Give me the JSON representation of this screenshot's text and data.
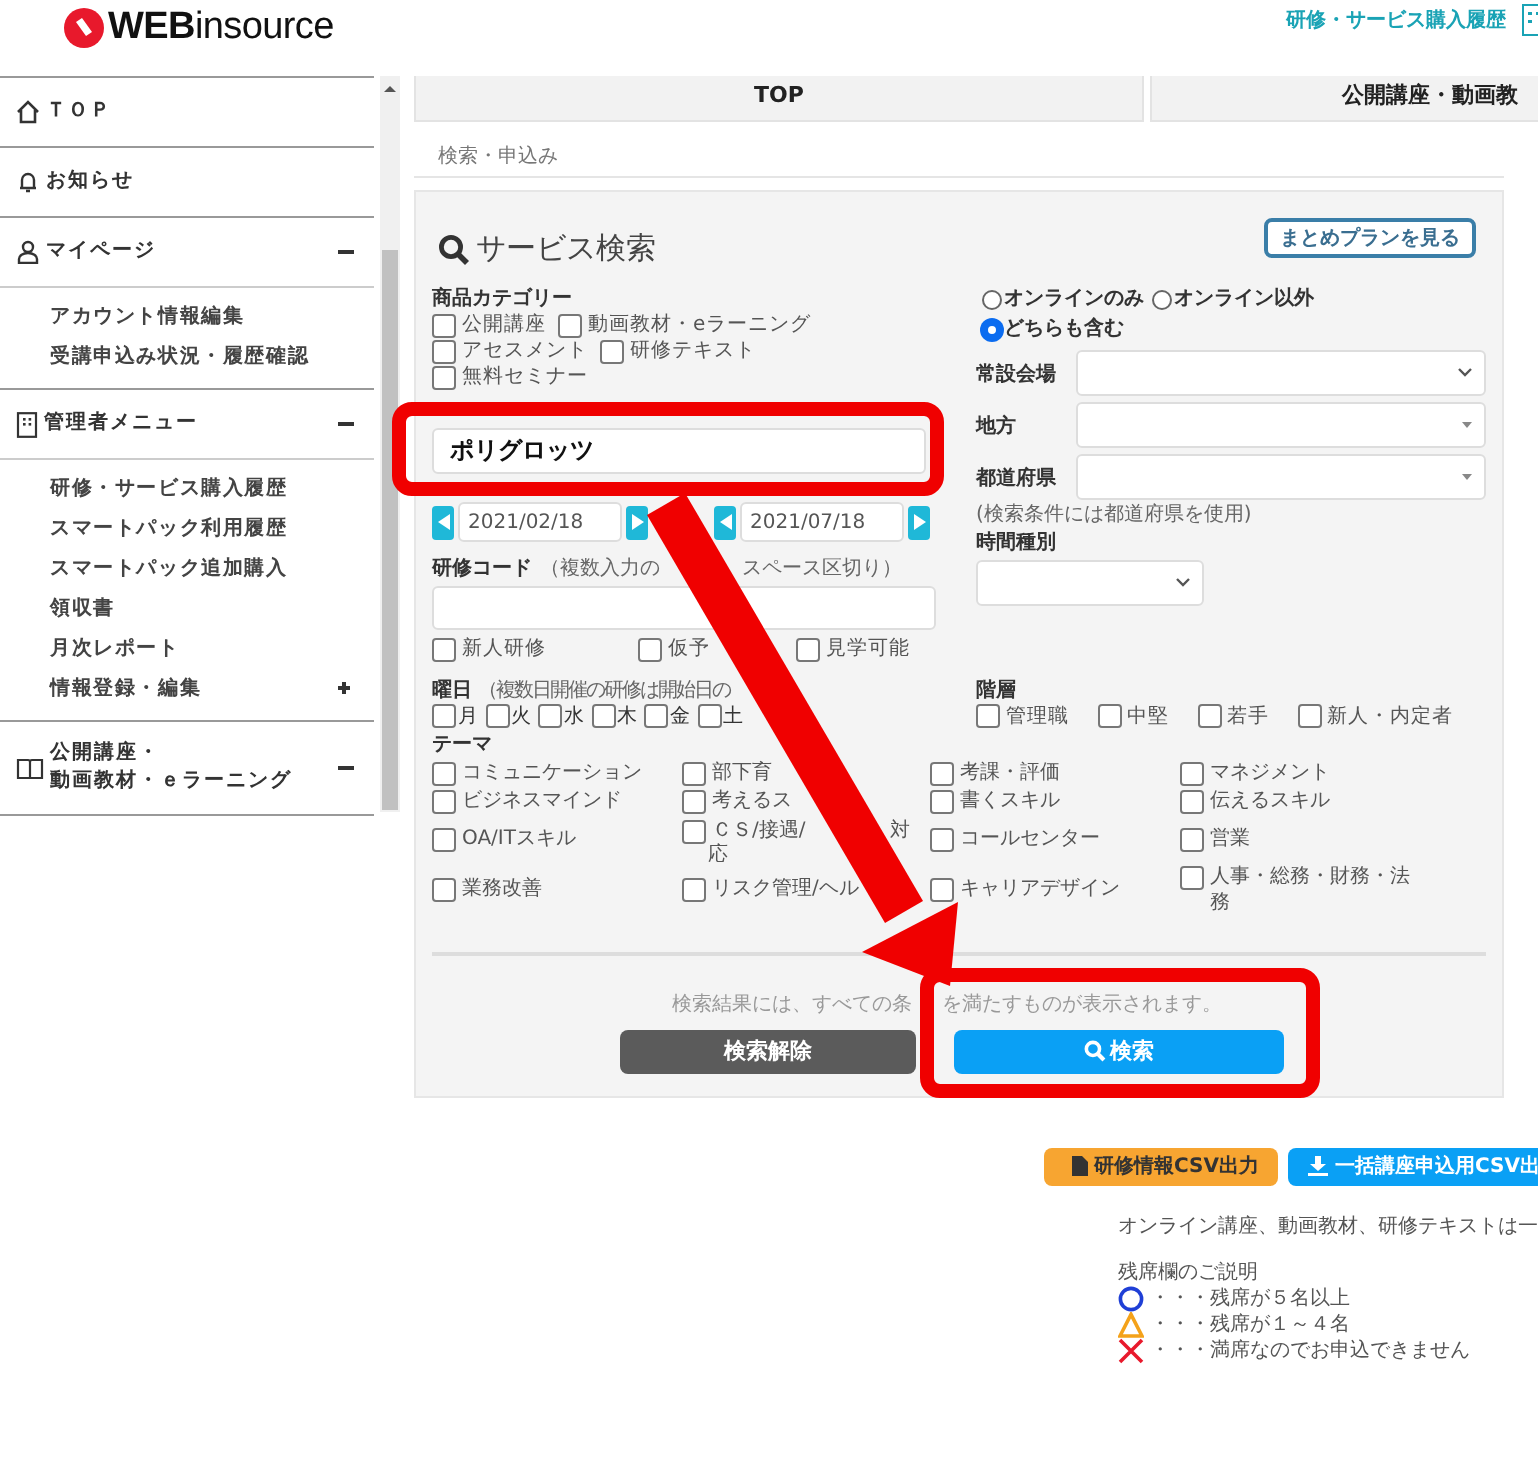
{
  "header": {
    "logo": "**WEB**insource",
    "link": "研修・サービス購入履歴"
  },
  "sidebar": {
    "sections": [
      {
        "label": "ＴＯＰ"
      },
      {
        "label": "お知らせ"
      },
      {
        "label": "マイページ",
        "expanded": true,
        "children": [
          {
            "label": "アカウント情報編集"
          },
          {
            "label": "受講申込み状況・履歴確認"
          }
        ]
      },
      {
        "label": "管理者メニュー",
        "expanded": true,
        "children": [
          {
            "label": "研修・サービス購入履歴"
          },
          {
            "label": "スマートパック利用履歴"
          },
          {
            "label": "スマートパック追加購入"
          },
          {
            "label": "領収書"
          },
          {
            "label": "月次レポート"
          },
          {
            "label": "情報登録・編集",
            "expanded": false
          }
        ]
      },
      {
        "label": "公開講座・動画教材・ｅラーニング",
        "expanded": true
      }
    ]
  },
  "tabs": [
    {
      "label": "TOP"
    },
    {
      "label": "公開講座・動画教"
    }
  ],
  "breadcrumb": "検索・申込み",
  "search": {
    "title": "サービス検索",
    "plan_button": "まとめプランを見る",
    "category_label": "商品カテゴリー",
    "categories": [
      {
        "label": "公開講座",
        "checked": false
      },
      {
        "label": "動画教材・eラーニング",
        "checked": false
      },
      {
        "label": "アセスメント",
        "checked": false
      },
      {
        "label": "研修テキスト",
        "checked": false
      },
      {
        "label": "無料セミナー",
        "checked": false
      }
    ],
    "keyword": "ポリグロッツ",
    "dates": [
      {
        "value": "2021/02/18"
      },
      {
        "value": "2021/07/18"
      }
    ],
    "code_label": "研修コード",
    "code_note": "（複数入力の",
    "code_note_tail": "スペース区切り）",
    "flags": [
      {
        "label": "新人研修",
        "checked": false
      },
      {
        "label": "仮予",
        "checked": false
      },
      {
        "label": "見学可能",
        "checked": false
      }
    ],
    "modes": [
      {
        "label": "オンラインのみ",
        "selected": false
      },
      {
        "label": "オンライン以外",
        "selected": false
      },
      {
        "label": "どちらも含む",
        "selected": true
      }
    ],
    "selects": [
      {
        "label": "常設会場"
      },
      {
        "label": "地方"
      },
      {
        "label": "都道府県"
      }
    ],
    "select_note": "(検索条件には都道府県を使用)",
    "time_label": "時間種別",
    "weekday_label": "曜日",
    "weekday_note": "（複数日開催の研修は開始日の",
    "weekdays": [
      {
        "label": "月",
        "checked": false
      },
      {
        "label": "火",
        "checked": false
      },
      {
        "label": "水",
        "checked": false
      },
      {
        "label": "木",
        "checked": false
      },
      {
        "label": "金",
        "checked": false
      },
      {
        "label": "土",
        "checked": false
      }
    ],
    "level_label": "階層",
    "levels": [
      {
        "label": "管理職",
        "checked": false
      },
      {
        "label": "中堅",
        "checked": false
      },
      {
        "label": "若手",
        "checked": false
      },
      {
        "label": "新人・内定者",
        "checked": false
      }
    ],
    "theme_label": "テーマ",
    "themes": [
      {
        "label": "コミュニケーション",
        "checked": false
      },
      {
        "label": "部下育",
        "checked": false
      },
      {
        "label": "考課・評価",
        "checked": false
      },
      {
        "label": "マネジメント",
        "checked": false
      },
      {
        "label": "ビジネスマインド",
        "checked": false
      },
      {
        "label": "考えるス",
        "checked": false
      },
      {
        "label": "書くスキル",
        "checked": false
      },
      {
        "label": "伝えるスキル",
        "checked": false
      },
      {
        "label": "OA/ITスキル",
        "checked": false
      },
      {
        "label": "ＣＳ/接遇/",
        "tail": "対",
        "tail_2": "応",
        "checked": false
      },
      {
        "label": "コールセンター",
        "checked": false
      },
      {
        "label": "営業",
        "checked": false
      },
      {
        "label": "業務改善",
        "checked": false
      },
      {
        "label": "リスク管理/ヘル",
        "checked": false
      },
      {
        "label": "キャリアデザイン",
        "checked": false
      },
      {
        "label": "人事・総務・財務・法務",
        "checked": false
      }
    ],
    "notice": "検索結果には、すべての条",
    "notice_tail": "を満たすものが表示されます。",
    "clear_button": "検索解除",
    "search_button": "検索"
  },
  "exports": [
    {
      "kind": "file",
      "label": "研修情報CSV出力"
    },
    {
      "kind": "download",
      "label": "一括講座申込用CSV出"
    }
  ],
  "info": "オンライン講座、動画教材、研修テキストは一",
  "legend": {
    "title": "残席欄のご説明",
    "items": [
      {
        "kind": "circle",
        "label": "・・・残席が５名以上"
      },
      {
        "kind": "triangle",
        "label": "・・・残席が１～４名"
      },
      {
        "kind": "cross",
        "label": "・・・満席なのでお申込できません"
      }
    ]
  }
}
